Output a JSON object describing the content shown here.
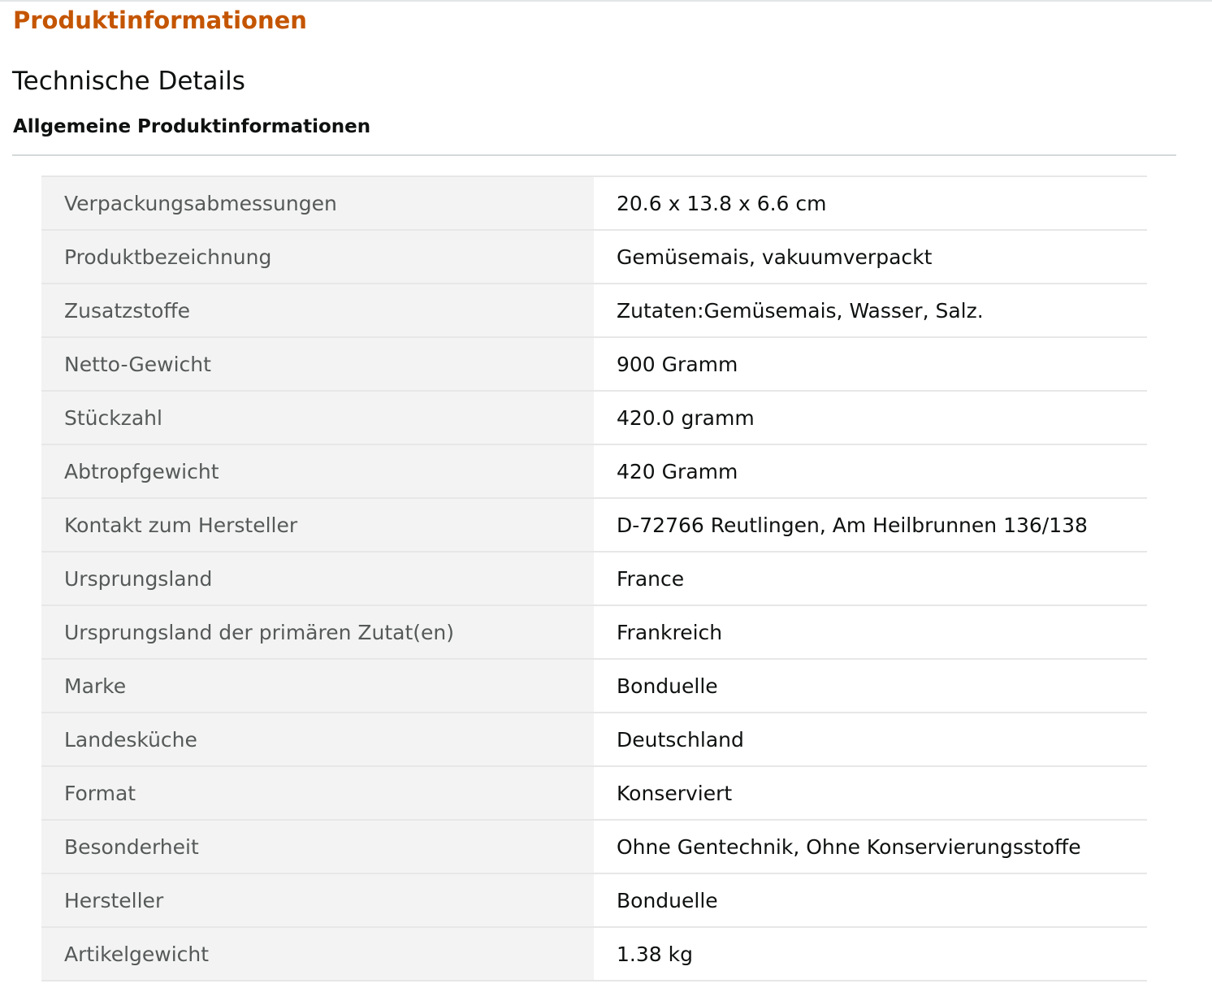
{
  "section_title": "Produktinformationen",
  "subsection_title": "Technische Details",
  "group_title": "Allgemeine Produktinformationen",
  "colors": {
    "section_title": "#c45500",
    "label_background": "#f3f3f3",
    "label_text": "#565959",
    "value_text": "#0f1111",
    "row_border": "#e7e7e7"
  },
  "details": [
    {
      "label": "Verpackungsabmessungen",
      "value": "20.6 x 13.8 x 6.6 cm"
    },
    {
      "label": "Produktbezeichnung",
      "value": "Gemüsemais, vakuumverpackt"
    },
    {
      "label": "Zusatzstoffe",
      "value": "Zutaten:Gemüsemais, Wasser, Salz."
    },
    {
      "label": "Netto-Gewicht",
      "value": "900 Gramm"
    },
    {
      "label": "Stückzahl",
      "value": "420.0 gramm"
    },
    {
      "label": "Abtropfgewicht",
      "value": "420 Gramm"
    },
    {
      "label": "Kontakt zum Hersteller",
      "value": "D-72766 Reutlingen, Am Heilbrunnen 136/138"
    },
    {
      "label": "Ursprungsland",
      "value": "France"
    },
    {
      "label": "Ursprungsland der primären Zutat(en)",
      "value": "Frankreich"
    },
    {
      "label": "Marke",
      "value": "Bonduelle"
    },
    {
      "label": "Landesküche",
      "value": "Deutschland"
    },
    {
      "label": "Format",
      "value": "Konserviert"
    },
    {
      "label": "Besonderheit",
      "value": "Ohne Gentechnik, Ohne Konservierungsstoffe"
    },
    {
      "label": "Hersteller",
      "value": "Bonduelle"
    },
    {
      "label": "Artikelgewicht",
      "value": "1.38 kg"
    }
  ]
}
